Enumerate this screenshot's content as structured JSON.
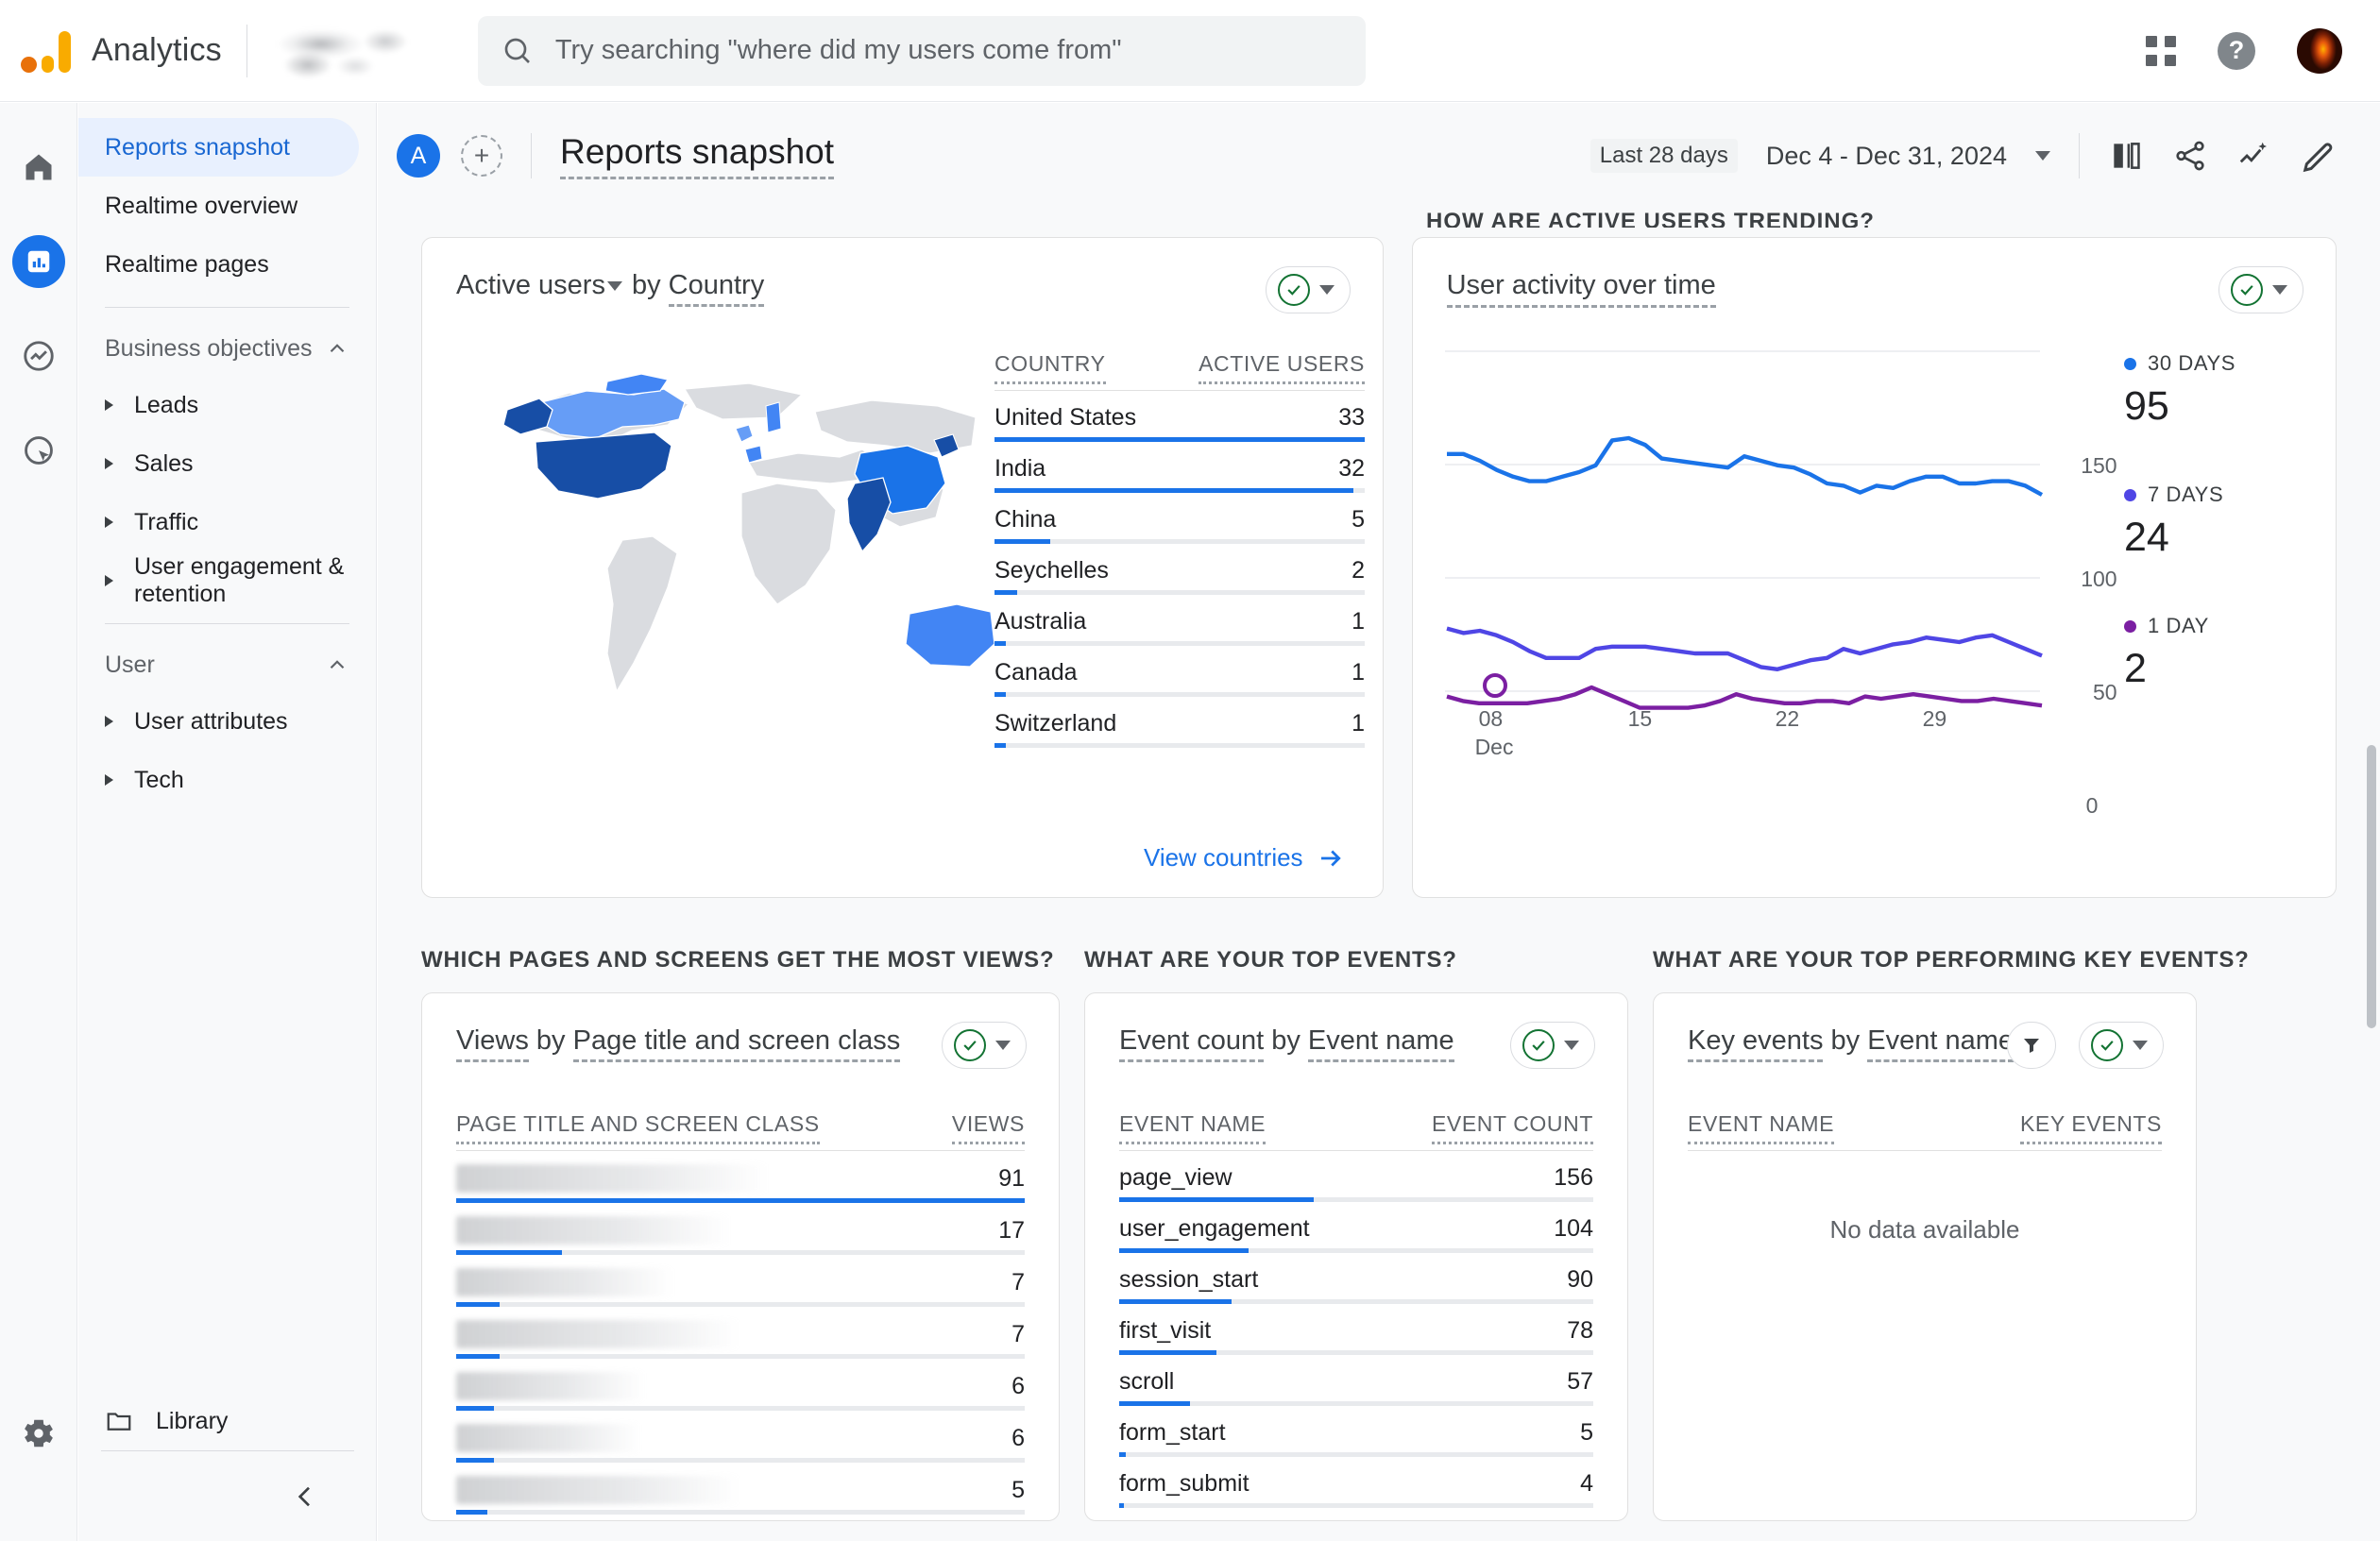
{
  "topbar": {
    "brand": "Analytics",
    "property_name_blurred": "",
    "search_placeholder": "Try searching \"where did my users come from\"",
    "search_icon": "search-icon",
    "apps_icon": "apps-grid-icon",
    "help_icon": "help-icon",
    "avatar": "user-avatar"
  },
  "rail": {
    "items": [
      {
        "name": "home-icon",
        "label": "Home",
        "active": false
      },
      {
        "name": "reports-icon",
        "label": "Reports",
        "active": true
      },
      {
        "name": "explore-icon",
        "label": "Explore",
        "active": false
      },
      {
        "name": "advertising-icon",
        "label": "Advertising",
        "active": false
      }
    ],
    "settings_icon": "gear-icon"
  },
  "sidebar": {
    "items": [
      {
        "label": "Reports snapshot",
        "selected": true
      },
      {
        "label": "Realtime overview",
        "selected": false
      },
      {
        "label": "Realtime pages",
        "selected": false
      }
    ],
    "sections": [
      {
        "title": "Business objectives",
        "collapse_icon": "chevron-up-icon",
        "children": [
          {
            "label": "Leads"
          },
          {
            "label": "Sales"
          },
          {
            "label": "Traffic"
          },
          {
            "label": "User engagement & retention"
          }
        ]
      },
      {
        "title": "User",
        "collapse_icon": "chevron-up-icon",
        "children": [
          {
            "label": "User attributes"
          },
          {
            "label": "Tech"
          }
        ]
      }
    ],
    "library": {
      "label": "Library",
      "icon": "folder-icon"
    },
    "collapse_icon": "chevron-left-icon"
  },
  "page": {
    "avatar_badge": "A",
    "add_badge": "+",
    "title": "Reports snapshot",
    "date_badge": "Last 28 days",
    "date_range": "Dec 4 - Dec 31, 2024",
    "actions": [
      {
        "name": "compare-icon"
      },
      {
        "name": "share-icon"
      },
      {
        "name": "insights-icon"
      },
      {
        "name": "edit-icon"
      }
    ],
    "cut_off_heading": "HOW ARE ACTIVE USERS TRENDING?"
  },
  "cards": {
    "map": {
      "metric": "Active users",
      "by_label": "by",
      "dimension": "Country",
      "columns": [
        "COUNTRY",
        "ACTIVE USERS"
      ],
      "rows": [
        {
          "country": "United States",
          "value": 33
        },
        {
          "country": "India",
          "value": 32
        },
        {
          "country": "China",
          "value": 5
        },
        {
          "country": "Seychelles",
          "value": 2
        },
        {
          "country": "Australia",
          "value": 1
        },
        {
          "country": "Canada",
          "value": 1
        },
        {
          "country": "Switzerland",
          "value": 1
        }
      ],
      "footer_link": "View countries",
      "footer_icon": "arrow-right-icon",
      "check_icon": "check-circle-icon",
      "dropdown_icon": "chevron-down-icon"
    },
    "activity": {
      "title": "User activity over time",
      "check_icon": "check-circle-icon",
      "dropdown_icon": "chevron-down-icon"
    },
    "pages": {
      "section_heading": "WHICH PAGES AND SCREENS GET THE MOST VIEWS?",
      "metric": "Views",
      "by_label": "by",
      "dimension": "Page title and screen class",
      "columns": [
        "PAGE TITLE AND SCREEN CLASS",
        "VIEWS"
      ],
      "rows": [
        {
          "label": "",
          "value": 91
        },
        {
          "label": "",
          "value": 17
        },
        {
          "label": "",
          "value": 7
        },
        {
          "label": "",
          "value": 7
        },
        {
          "label": "",
          "value": 6
        },
        {
          "label": "",
          "value": 6
        },
        {
          "label": "",
          "value": 5
        }
      ]
    },
    "events": {
      "section_heading": "WHAT ARE YOUR TOP EVENTS?",
      "metric": "Event count",
      "by_label": "by",
      "dimension": "Event name",
      "columns": [
        "EVENT NAME",
        "EVENT COUNT"
      ],
      "rows": [
        {
          "label": "page_view",
          "value": 156
        },
        {
          "label": "user_engagement",
          "value": 104
        },
        {
          "label": "session_start",
          "value": 90
        },
        {
          "label": "first_visit",
          "value": 78
        },
        {
          "label": "scroll",
          "value": 57
        },
        {
          "label": "form_start",
          "value": 5
        },
        {
          "label": "form_submit",
          "value": 4
        }
      ]
    },
    "key_events": {
      "section_heading": "WHAT ARE YOUR TOP PERFORMING KEY EVENTS?",
      "metric": "Key events",
      "by_label": "by",
      "dimension": "Event name",
      "columns": [
        "EVENT NAME",
        "KEY EVENTS"
      ],
      "empty_message": "No data available",
      "filter_icon": "filter-icon"
    }
  },
  "chart_data": {
    "type": "line",
    "title": "User activity over time",
    "xlabel": "Dec",
    "ylabel": "",
    "ylim": [
      0,
      150
    ],
    "yticks": [
      0,
      50,
      100,
      150
    ],
    "xticks": [
      "08",
      "15",
      "22",
      "29"
    ],
    "x_axis_month": "Dec",
    "grid": true,
    "legend_position": "right",
    "series": [
      {
        "name": "30 DAYS",
        "current_value": 95,
        "color": "#1a73e8",
        "values": [
          113,
          113,
          110,
          106,
          103,
          101,
          101,
          103,
          105,
          108,
          119,
          120,
          117,
          111,
          110,
          109,
          108,
          107,
          112,
          110,
          108,
          107,
          104,
          100,
          99,
          96,
          99,
          98,
          101,
          103,
          103,
          100,
          100,
          101,
          101,
          99,
          95
        ]
      },
      {
        "name": "7 DAYS",
        "current_value": 24,
        "color": "#4f46e5",
        "values": [
          36,
          34,
          35,
          33,
          30,
          26,
          23,
          23,
          23,
          27,
          28,
          28,
          28,
          27,
          26,
          25,
          25,
          25,
          22,
          19,
          18,
          20,
          22,
          23,
          27,
          25,
          27,
          29,
          30,
          32,
          31,
          30,
          32,
          33,
          30,
          27,
          24
        ]
      },
      {
        "name": "1 DAY",
        "current_value": 2,
        "color": "#7b1fa2",
        "values": [
          6,
          4,
          3,
          3,
          3,
          3,
          4,
          5,
          7,
          10,
          7,
          4,
          1,
          1,
          1,
          1,
          2,
          4,
          7,
          5,
          4,
          3,
          3,
          4,
          4,
          3,
          6,
          5,
          6,
          7,
          6,
          5,
          4,
          4,
          5,
          4,
          3,
          2
        ]
      }
    ]
  },
  "colors": {
    "accent_blue": "#1a73e8",
    "purple": "#4f46e5",
    "dark_purple": "#7b1fa2",
    "green_check": "#137333",
    "orange": "#f9ab00",
    "map_high": "#174ea6",
    "map_mid": "#1a73e8",
    "map_low": "#669df6",
    "map_none": "#dadce0"
  }
}
